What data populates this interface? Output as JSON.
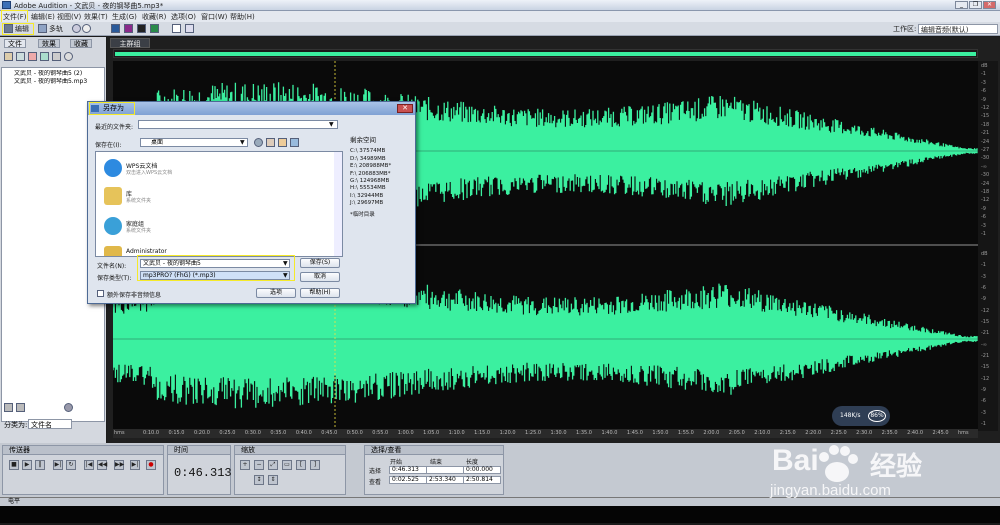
{
  "window": {
    "title": "Adobe Audition - 文武贝 - 夜的钢琴曲5.mp3*"
  },
  "menu": [
    "文件(F)",
    "编辑(E)",
    "视图(V)",
    "效果(T)",
    "生成(G)",
    "收藏(R)",
    "选项(O)",
    "窗口(W)",
    "帮助(H)"
  ],
  "toolbar": {
    "edit_label": "编辑",
    "multitrack_label": "多轨",
    "workspace_label": "工作区:",
    "workspace_value": "编辑音频(默认)"
  },
  "left_panel": {
    "tabs": [
      "文件",
      "效果",
      "收藏"
    ],
    "files": [
      "文武贝 - 夜的钢琴曲5 (2)",
      "文武贝 - 夜的钢琴曲5.mp3"
    ],
    "sort_label": "分类为:",
    "sort_value": "文件名"
  },
  "main": {
    "tab": "主群组",
    "ruler": [
      "hms",
      "0:10.0",
      "0:15.0",
      "0:20.0",
      "0:25.0",
      "0:30.0",
      "0:35.0",
      "0:40.0",
      "0:45.0",
      "0:50.0",
      "0:55.0",
      "1:00.0",
      "1:05.0",
      "1:10.0",
      "1:15.0",
      "1:20.0",
      "1:25.0",
      "1:30.0",
      "1:35.0",
      "1:40.0",
      "1:45.0",
      "1:50.0",
      "1:55.0",
      "2:00.0",
      "2:05.0",
      "2:10.0",
      "2:15.0",
      "2:20.0",
      "2:25.0",
      "2:30.0",
      "2:35.0",
      "2:40.0",
      "2:45.0",
      "hms"
    ],
    "db_top": [
      "dB",
      "-1",
      "-3",
      "-6",
      "-9",
      "-12",
      "-15",
      "-18",
      "-21",
      "-24",
      "-27",
      "-30",
      "-∞",
      "-30",
      "-24",
      "-18",
      "-12",
      "-9",
      "-6",
      "-3",
      "-1"
    ],
    "db_bottom": [
      "dB",
      "-1",
      "-3",
      "-6",
      "-9",
      "-12",
      "-15",
      "-21",
      "-∞",
      "-21",
      "-15",
      "-12",
      "-9",
      "-6",
      "-3",
      "-1"
    ]
  },
  "transport": {
    "title": "传送器"
  },
  "time": {
    "title": "时间",
    "value": "0:46.313"
  },
  "zoom": {
    "title": "缩放"
  },
  "selection": {
    "title": "选择/查看",
    "col_start": "开始",
    "col_end": "结束",
    "col_length": "长度",
    "row_select": "选择",
    "row_view": "查看",
    "select_start": "0:46.313",
    "select_end": "",
    "select_length": "0:00.000",
    "view_start": "0:02.525",
    "view_end": "2:53.340",
    "view_length": "2:50.814"
  },
  "levels": {
    "title": "电平"
  },
  "dialog": {
    "title": "另存为",
    "recent_label": "最近的文件夹:",
    "savein_label": "保存在(I):",
    "savein_value": "桌面",
    "items": [
      {
        "name": "WPS云文档",
        "desc": "双击进入WPS云文档"
      },
      {
        "name": "库",
        "desc": "系统文件夹"
      },
      {
        "name": "家庭组",
        "desc": "系统文件夹"
      },
      {
        "name": "Administrator",
        "desc": ""
      }
    ],
    "free_space_title": "剩余空间",
    "drives": [
      "C:\\  37574MB",
      "D:\\  34989MB",
      "E:\\  208988MB*",
      "F:\\  206883MB*",
      "G:\\  124968MB",
      "H:\\  55534MB",
      "I:\\  32944MB",
      "J:\\  29697MB"
    ],
    "temp_note": "*临时目录",
    "filename_label": "文件名(N):",
    "filename_value": "文武贝 - 夜的钢琴曲5",
    "filetype_label": "保存类型(T):",
    "filetype_value": "mp3PRO? (FhG) (*.mp3)",
    "save_btn": "保存(S)",
    "cancel_btn": "取消",
    "help_btn": "帮助(H)",
    "options_btn": "选项",
    "extra_check": "额外保存非音频信息"
  },
  "overlay": {
    "speed": "148K/s",
    "percent": "86%"
  },
  "watermark": {
    "brand": "Bai",
    "brand_cn": "经验",
    "url": "jingyan.baidu.com"
  },
  "colors": {
    "wave": "#3bf0a0",
    "highlight": "#f5ea2a"
  }
}
